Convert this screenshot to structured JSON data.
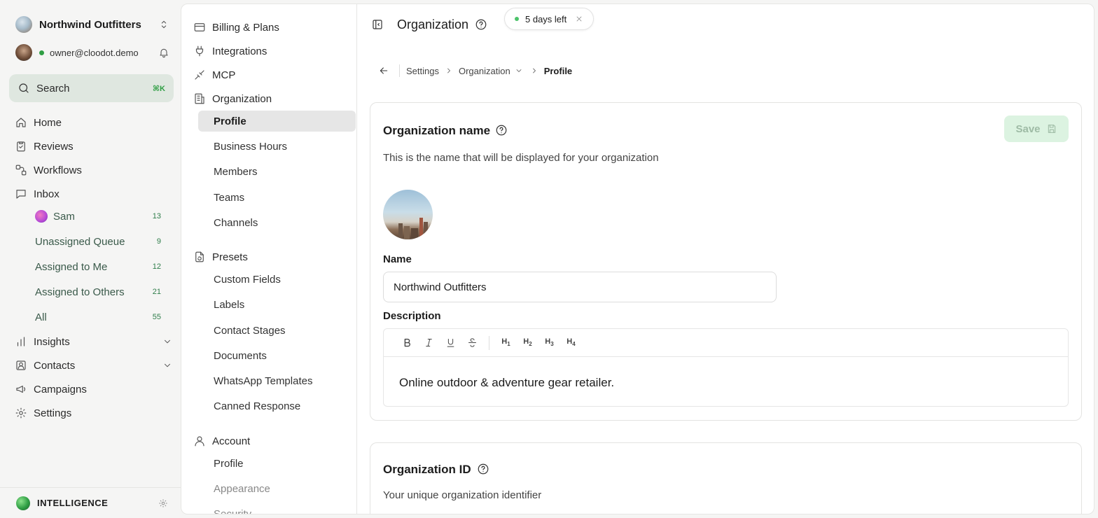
{
  "workspace": {
    "name": "Northwind Outfitters"
  },
  "user": {
    "email": "owner@cloodot.demo"
  },
  "search": {
    "label": "Search",
    "shortcut": "⌘K"
  },
  "nav": {
    "home": "Home",
    "reviews": "Reviews",
    "workflows": "Workflows",
    "inbox": "Inbox",
    "inbox_items": [
      {
        "label": "Sam",
        "count": "13"
      },
      {
        "label": "Unassigned Queue",
        "count": "9"
      },
      {
        "label": "Assigned to Me",
        "count": "12"
      },
      {
        "label": "Assigned to Others",
        "count": "21"
      },
      {
        "label": "All",
        "count": "55"
      }
    ],
    "insights": "Insights",
    "contacts": "Contacts",
    "campaigns": "Campaigns",
    "settings": "Settings"
  },
  "intelligence": {
    "label": "INTELLIGENCE"
  },
  "settings_menu": {
    "billing": "Billing & Plans",
    "integrations": "Integrations",
    "mcp": "MCP",
    "organization": "Organization",
    "org_items": [
      "Profile",
      "Business Hours",
      "Members",
      "Teams",
      "Channels"
    ],
    "presets": "Presets",
    "preset_items": [
      "Custom Fields",
      "Labels",
      "Contact Stages",
      "Documents",
      "WhatsApp Templates",
      "Canned Response"
    ],
    "account": "Account",
    "account_items": [
      "Profile",
      "Appearance",
      "Security"
    ]
  },
  "header": {
    "title": "Organization",
    "trial": "5 days left"
  },
  "breadcrumb": {
    "settings": "Settings",
    "organization": "Organization",
    "current": "Profile"
  },
  "org_name_card": {
    "title": "Organization name",
    "description": "This is the name that will be displayed for your organization",
    "save_label": "Save",
    "name_label": "Name",
    "name_value": "Northwind Outfitters",
    "description_label": "Description",
    "description_value": "Online outdoor & adventure gear retailer."
  },
  "toolbar": {
    "h1": "H",
    "h2": "H",
    "h3": "H",
    "h4": "H",
    "n1": "1",
    "n2": "2",
    "n3": "3",
    "n4": "4"
  },
  "org_id_card": {
    "title": "Organization ID",
    "description": "Your unique organization identifier"
  },
  "colors": {
    "accent": "#2f9e44",
    "save_bg": "#dcf3e1",
    "search_bg": "#dfe7e0"
  }
}
